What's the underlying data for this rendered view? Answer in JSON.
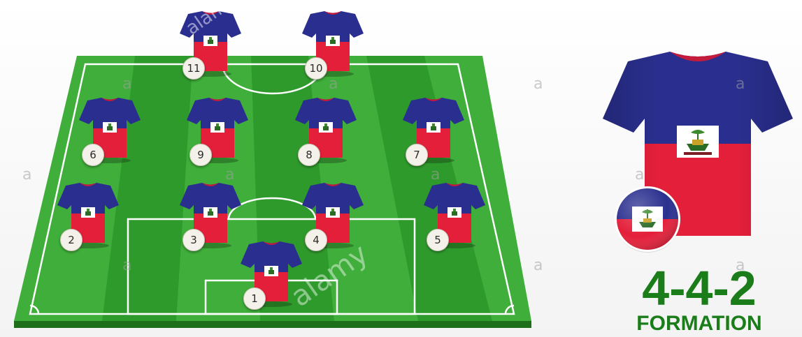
{
  "formation": {
    "label": "4-4-2",
    "word": "FORMATION"
  },
  "team_colors": {
    "shirt_top": "#2a2f8f",
    "shirt_bottom": "#e41f3a",
    "collar": "#c41a3b",
    "pitch_light": "#3fae3a",
    "pitch_dark": "#2f9a2c",
    "pitch_edge": "#1e6f1c",
    "lines": "#ffffff",
    "accent_text": "#1b7d1a"
  },
  "players": [
    {
      "number": "1",
      "role": "goalkeeper"
    },
    {
      "number": "2",
      "role": "defender"
    },
    {
      "number": "3",
      "role": "defender"
    },
    {
      "number": "4",
      "role": "defender"
    },
    {
      "number": "5",
      "role": "defender"
    },
    {
      "number": "6",
      "role": "midfielder"
    },
    {
      "number": "9",
      "role": "midfielder"
    },
    {
      "number": "8",
      "role": "midfielder"
    },
    {
      "number": "7",
      "role": "midfielder"
    },
    {
      "number": "11",
      "role": "forward"
    },
    {
      "number": "10",
      "role": "forward"
    }
  ],
  "watermark": {
    "brand": "alamy",
    "letter": "a"
  }
}
